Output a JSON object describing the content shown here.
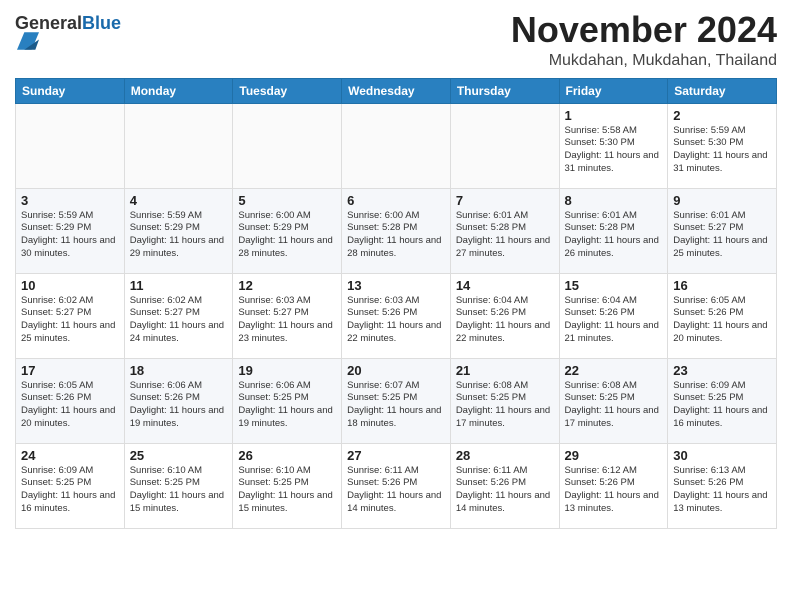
{
  "header": {
    "logo_general": "General",
    "logo_blue": "Blue",
    "month_title": "November 2024",
    "subtitle": "Mukdahan, Mukdahan, Thailand"
  },
  "weekdays": [
    "Sunday",
    "Monday",
    "Tuesday",
    "Wednesday",
    "Thursday",
    "Friday",
    "Saturday"
  ],
  "weeks": [
    [
      {
        "day": "",
        "info": ""
      },
      {
        "day": "",
        "info": ""
      },
      {
        "day": "",
        "info": ""
      },
      {
        "day": "",
        "info": ""
      },
      {
        "day": "",
        "info": ""
      },
      {
        "day": "1",
        "info": "Sunrise: 5:58 AM\nSunset: 5:30 PM\nDaylight: 11 hours and 31 minutes."
      },
      {
        "day": "2",
        "info": "Sunrise: 5:59 AM\nSunset: 5:30 PM\nDaylight: 11 hours and 31 minutes."
      }
    ],
    [
      {
        "day": "3",
        "info": "Sunrise: 5:59 AM\nSunset: 5:29 PM\nDaylight: 11 hours and 30 minutes."
      },
      {
        "day": "4",
        "info": "Sunrise: 5:59 AM\nSunset: 5:29 PM\nDaylight: 11 hours and 29 minutes."
      },
      {
        "day": "5",
        "info": "Sunrise: 6:00 AM\nSunset: 5:29 PM\nDaylight: 11 hours and 28 minutes."
      },
      {
        "day": "6",
        "info": "Sunrise: 6:00 AM\nSunset: 5:28 PM\nDaylight: 11 hours and 28 minutes."
      },
      {
        "day": "7",
        "info": "Sunrise: 6:01 AM\nSunset: 5:28 PM\nDaylight: 11 hours and 27 minutes."
      },
      {
        "day": "8",
        "info": "Sunrise: 6:01 AM\nSunset: 5:28 PM\nDaylight: 11 hours and 26 minutes."
      },
      {
        "day": "9",
        "info": "Sunrise: 6:01 AM\nSunset: 5:27 PM\nDaylight: 11 hours and 25 minutes."
      }
    ],
    [
      {
        "day": "10",
        "info": "Sunrise: 6:02 AM\nSunset: 5:27 PM\nDaylight: 11 hours and 25 minutes."
      },
      {
        "day": "11",
        "info": "Sunrise: 6:02 AM\nSunset: 5:27 PM\nDaylight: 11 hours and 24 minutes."
      },
      {
        "day": "12",
        "info": "Sunrise: 6:03 AM\nSunset: 5:27 PM\nDaylight: 11 hours and 23 minutes."
      },
      {
        "day": "13",
        "info": "Sunrise: 6:03 AM\nSunset: 5:26 PM\nDaylight: 11 hours and 22 minutes."
      },
      {
        "day": "14",
        "info": "Sunrise: 6:04 AM\nSunset: 5:26 PM\nDaylight: 11 hours and 22 minutes."
      },
      {
        "day": "15",
        "info": "Sunrise: 6:04 AM\nSunset: 5:26 PM\nDaylight: 11 hours and 21 minutes."
      },
      {
        "day": "16",
        "info": "Sunrise: 6:05 AM\nSunset: 5:26 PM\nDaylight: 11 hours and 20 minutes."
      }
    ],
    [
      {
        "day": "17",
        "info": "Sunrise: 6:05 AM\nSunset: 5:26 PM\nDaylight: 11 hours and 20 minutes."
      },
      {
        "day": "18",
        "info": "Sunrise: 6:06 AM\nSunset: 5:26 PM\nDaylight: 11 hours and 19 minutes."
      },
      {
        "day": "19",
        "info": "Sunrise: 6:06 AM\nSunset: 5:25 PM\nDaylight: 11 hours and 19 minutes."
      },
      {
        "day": "20",
        "info": "Sunrise: 6:07 AM\nSunset: 5:25 PM\nDaylight: 11 hours and 18 minutes."
      },
      {
        "day": "21",
        "info": "Sunrise: 6:08 AM\nSunset: 5:25 PM\nDaylight: 11 hours and 17 minutes."
      },
      {
        "day": "22",
        "info": "Sunrise: 6:08 AM\nSunset: 5:25 PM\nDaylight: 11 hours and 17 minutes."
      },
      {
        "day": "23",
        "info": "Sunrise: 6:09 AM\nSunset: 5:25 PM\nDaylight: 11 hours and 16 minutes."
      }
    ],
    [
      {
        "day": "24",
        "info": "Sunrise: 6:09 AM\nSunset: 5:25 PM\nDaylight: 11 hours and 16 minutes."
      },
      {
        "day": "25",
        "info": "Sunrise: 6:10 AM\nSunset: 5:25 PM\nDaylight: 11 hours and 15 minutes."
      },
      {
        "day": "26",
        "info": "Sunrise: 6:10 AM\nSunset: 5:25 PM\nDaylight: 11 hours and 15 minutes."
      },
      {
        "day": "27",
        "info": "Sunrise: 6:11 AM\nSunset: 5:26 PM\nDaylight: 11 hours and 14 minutes."
      },
      {
        "day": "28",
        "info": "Sunrise: 6:11 AM\nSunset: 5:26 PM\nDaylight: 11 hours and 14 minutes."
      },
      {
        "day": "29",
        "info": "Sunrise: 6:12 AM\nSunset: 5:26 PM\nDaylight: 11 hours and 13 minutes."
      },
      {
        "day": "30",
        "info": "Sunrise: 6:13 AM\nSunset: 5:26 PM\nDaylight: 11 hours and 13 minutes."
      }
    ]
  ]
}
